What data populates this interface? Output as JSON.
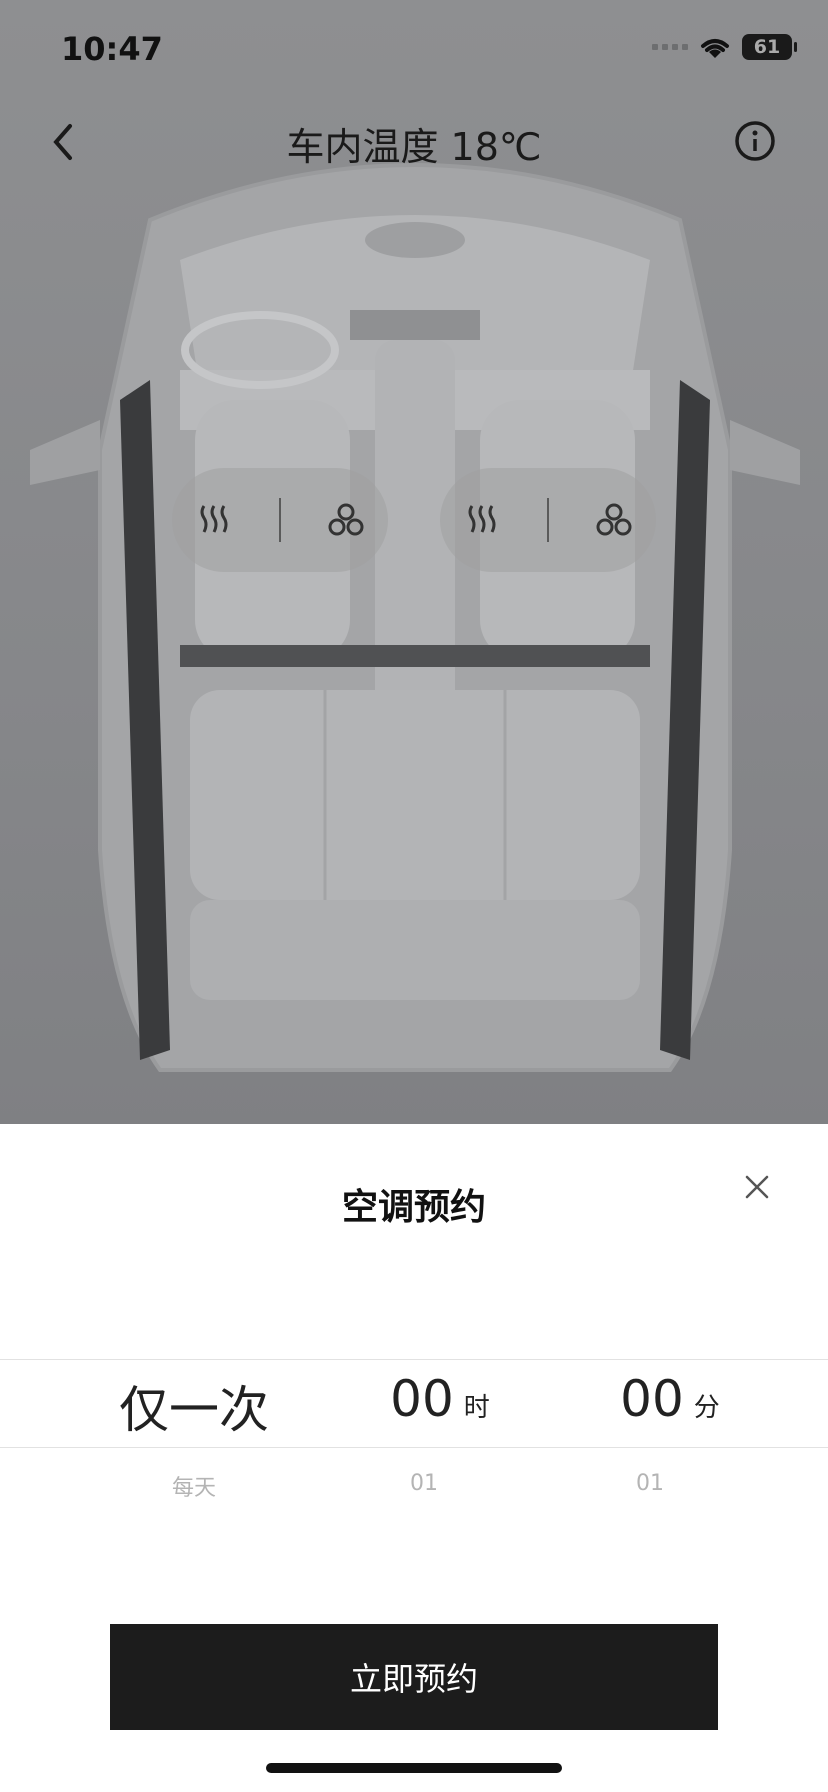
{
  "status_bar": {
    "time": "10:47",
    "battery": "61"
  },
  "nav": {
    "title": "车内温度 18℃"
  },
  "seat_controls": [
    {
      "heat_icon": "seat-heat-icon",
      "vent_icon": "seat-ventilation-icon"
    },
    {
      "heat_icon": "seat-heat-icon",
      "vent_icon": "seat-ventilation-icon"
    }
  ],
  "sheet": {
    "title": "空调预约",
    "picker": {
      "repeat": {
        "selected": "仅一次",
        "next": "每天"
      },
      "hour": {
        "selected": "00",
        "unit": "时",
        "next": "01"
      },
      "minute": {
        "selected": "00",
        "unit": "分",
        "next": "01"
      }
    },
    "cta_label": "立即预约"
  },
  "colors": {
    "overlay_bg": "#8a8b8d",
    "cta_bg": "#1c1c1c",
    "sheet_bg": "#ffffff"
  }
}
